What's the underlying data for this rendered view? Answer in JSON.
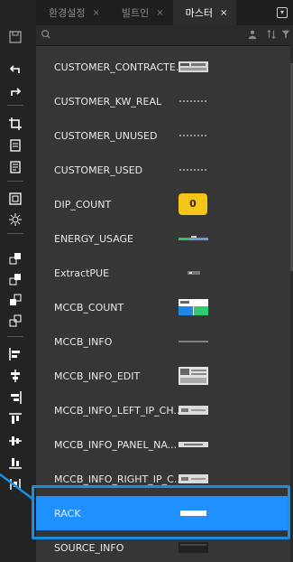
{
  "tabs": [
    {
      "label": "환경설정",
      "close": "×",
      "active": false
    },
    {
      "label": "빌트인",
      "close": "×",
      "active": false
    },
    {
      "label": "마스터",
      "close": "×",
      "active": true
    }
  ],
  "search": {
    "icon": "search-icon",
    "placeholder": "",
    "value": ""
  },
  "toolbar_icons": [
    "save-icon",
    "undo-icon",
    "redo-icon",
    "crop-icon",
    "page-icon",
    "document-icon",
    "group-icon",
    "component-icon",
    "bring-front-icon",
    "bring-forward-icon",
    "send-backward-icon",
    "send-back-icon",
    "align-left-icon",
    "align-center-icon",
    "align-right-icon",
    "align-top-icon",
    "align-middle-icon",
    "align-bottom-icon",
    "distribute-icon"
  ],
  "items": [
    {
      "label": "CUSTOMER_CONTRACTE...",
      "thumb": "panel"
    },
    {
      "label": "CUSTOMER_KW_REAL",
      "thumb": "dots"
    },
    {
      "label": "CUSTOMER_UNUSED",
      "thumb": "dots"
    },
    {
      "label": "CUSTOMER_USED",
      "thumb": "dots"
    },
    {
      "label": "DIP_COUNT",
      "thumb": "badge",
      "badge_value": "0"
    },
    {
      "label": "ENERGY_USAGE",
      "thumb": "bar"
    },
    {
      "label": "ExtractPUE",
      "thumb": "tiny"
    },
    {
      "label": "MCCB_COUNT",
      "thumb": "grid"
    },
    {
      "label": "MCCB_INFO",
      "thumb": "line"
    },
    {
      "label": "MCCB_INFO_EDIT",
      "thumb": "panel2"
    },
    {
      "label": "MCCB_INFO_LEFT_IP_CH...",
      "thumb": "strip"
    },
    {
      "label": "MCCB_INFO_PANEL_NA...",
      "thumb": "strip2"
    },
    {
      "label": "MCCB_INFO_RIGHT_IP_C...",
      "thumb": "strip"
    },
    {
      "label": "RACK",
      "thumb": "rack",
      "selected": true
    },
    {
      "label": "SOURCE_INFO",
      "thumb": "dark"
    }
  ],
  "colors": {
    "selected": "#1e90ff",
    "highlight": "#1a8fdf",
    "badge": "#f5c518"
  }
}
